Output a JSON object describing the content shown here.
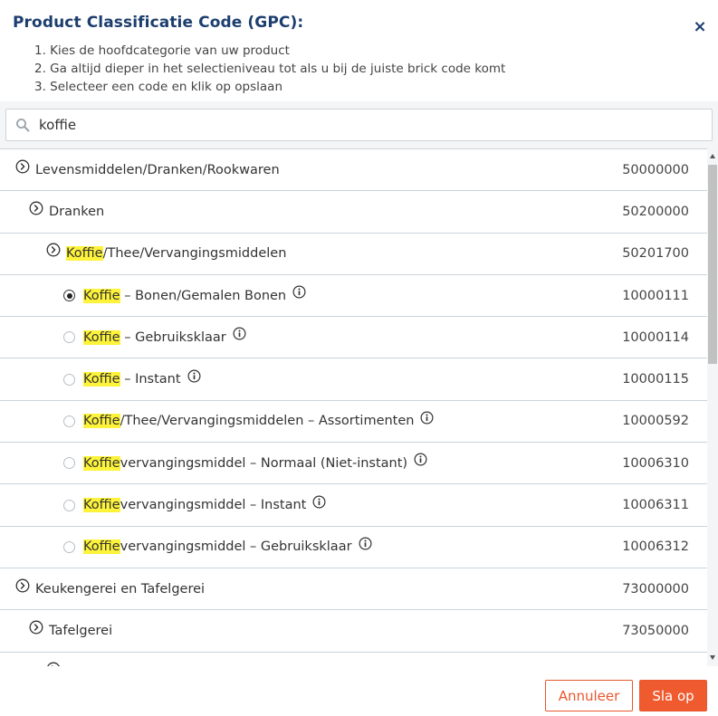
{
  "dialog": {
    "title": "Product Classificatie Code (GPC):",
    "close_label": "×",
    "instructions": [
      "1. Kies de hoofdcategorie van uw product",
      "2. Ga altijd dieper in het selectieniveau tot als u bij de juiste brick code komt",
      "3. Selecteer een code en klik op opslaan"
    ]
  },
  "search": {
    "value": "koffie",
    "placeholder": ""
  },
  "tree": {
    "rows": [
      {
        "type": "branch",
        "level": 0,
        "pre": "",
        "hl": "",
        "post": "Levensmiddelen/Dranken/Rookwaren",
        "code": "50000000"
      },
      {
        "type": "branch",
        "level": 1,
        "pre": "",
        "hl": "",
        "post": "Dranken",
        "code": "50200000"
      },
      {
        "type": "branch",
        "level": 2,
        "pre": "",
        "hl": "Koffie",
        "post": "/Thee/Vervangingsmiddelen",
        "code": "50201700"
      },
      {
        "type": "leaf",
        "level": 3,
        "checked": true,
        "hl": "Koffie",
        "post": " – Bonen/Gemalen Bonen",
        "code": "10000111"
      },
      {
        "type": "leaf",
        "level": 3,
        "checked": false,
        "hl": "Koffie",
        "post": " – Gebruiksklaar",
        "code": "10000114"
      },
      {
        "type": "leaf",
        "level": 3,
        "checked": false,
        "hl": "Koffie",
        "post": " – Instant",
        "code": "10000115"
      },
      {
        "type": "leaf",
        "level": 3,
        "checked": false,
        "hl": "Koffie",
        "post": "/Thee/Vervangingsmiddelen – Assortimenten",
        "code": "10000592"
      },
      {
        "type": "leaf",
        "level": 3,
        "checked": false,
        "hl": "Koffie",
        "post": "vervangingsmiddel – Normaal (Niet-instant)",
        "code": "10006310"
      },
      {
        "type": "leaf",
        "level": 3,
        "checked": false,
        "hl": "Koffie",
        "post": "vervangingsmiddel – Instant",
        "code": "10006311"
      },
      {
        "type": "leaf",
        "level": 3,
        "checked": false,
        "hl": "Koffie",
        "post": "vervangingsmiddel – Gebruiksklaar",
        "code": "10006312"
      },
      {
        "type": "branch",
        "level": 0,
        "pre": "",
        "hl": "",
        "post": "Keukengerei en Tafelgerei",
        "code": "73000000"
      },
      {
        "type": "branch",
        "level": 1,
        "pre": "",
        "hl": "",
        "post": "Tafelgerei",
        "code": "73050000"
      },
      {
        "type": "branch",
        "level": 2,
        "pre": "",
        "hl": "",
        "post": "",
        "code": ""
      }
    ]
  },
  "footer": {
    "cancel_label": "Annuleer",
    "save_label": "Sla op"
  },
  "colors": {
    "title": "#1c3e6e",
    "accent": "#ef5a2f",
    "highlight": "#fdf33a"
  }
}
